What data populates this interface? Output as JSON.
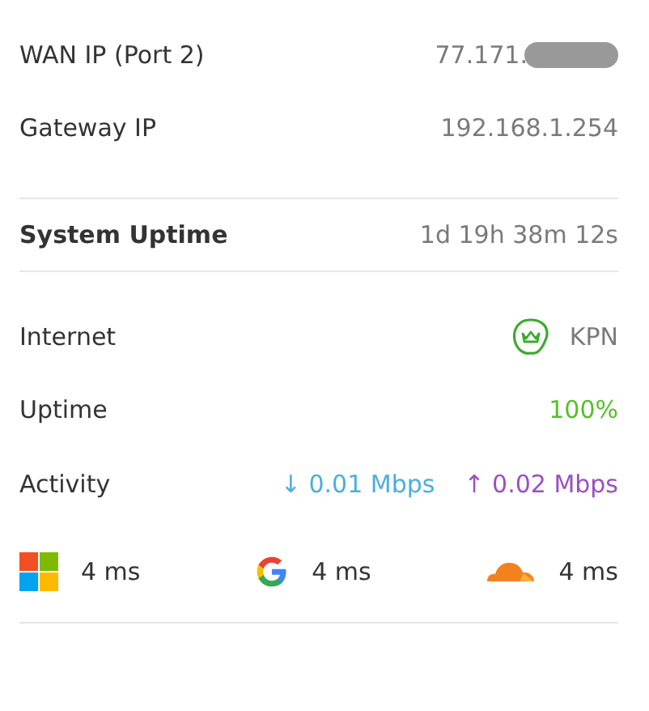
{
  "wan": [
    {
      "label": "WAN IP (Port 2)",
      "value": "77.171.",
      "redacted": true
    },
    {
      "label": "Gateway IP",
      "value": "192.168.1.254",
      "redacted": false
    }
  ],
  "system_uptime": {
    "label": "System Uptime",
    "value": "1d 19h 38m 12s"
  },
  "internet": {
    "label": "Internet",
    "provider": "KPN"
  },
  "uptime": {
    "label": "Uptime",
    "value": "100%",
    "color": "#55c02c"
  },
  "activity": {
    "label": "Activity",
    "rates": [
      {
        "color": "#4aaee0",
        "arrow": "↓",
        "value": "0.01 Mbps"
      },
      {
        "color": "#9b4fc4",
        "arrow": "↑",
        "value": "0.02 Mbps"
      }
    ]
  },
  "latencies": [
    {
      "kind": "squares",
      "value": "4 ms"
    },
    {
      "kind": "g",
      "value": "4 ms"
    },
    {
      "kind": "cloud",
      "value": "4 ms"
    }
  ]
}
